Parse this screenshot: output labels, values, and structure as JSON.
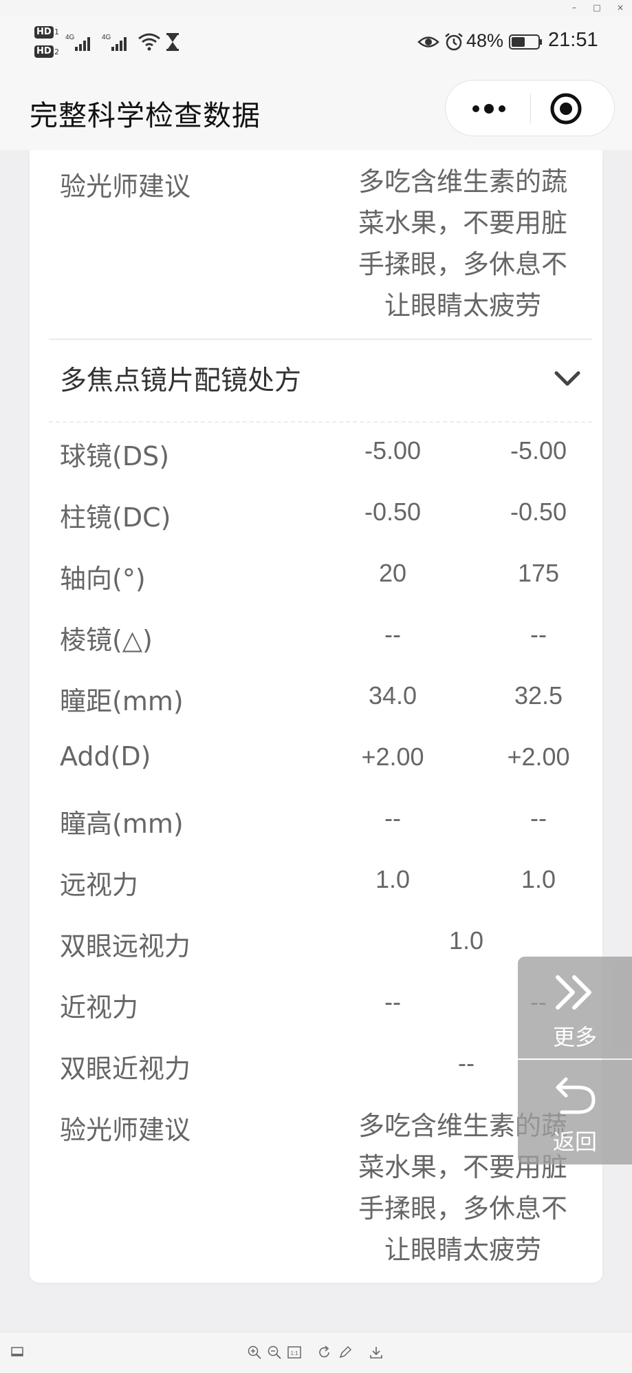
{
  "window": {
    "minimize": "–",
    "maximize": "□",
    "close": "×"
  },
  "status_bar": {
    "sim1": "HD",
    "sim1_sub": "1",
    "sim2": "HD",
    "sim2_sub": "2",
    "network1": "4G",
    "network2": "4G",
    "battery": "48%",
    "time": "21:51",
    "icons": [
      "signal-icon",
      "signal-icon",
      "wifi-icon",
      "hourglass-icon",
      "eye-icon",
      "alarm-icon",
      "battery-icon"
    ]
  },
  "nav": {
    "title": "完整科学检查数据",
    "more_icon": "more-dots-icon",
    "close_icon": "target-close-icon"
  },
  "top_advice": {
    "label": "验光师建议",
    "text": "多吃含维生素的蔬菜水果，不要用脏手揉眼，多休息不让眼睛太疲劳"
  },
  "section": {
    "title": "多焦点镜片配镜处方",
    "toggle_icon": "chevron-down-icon"
  },
  "rows": [
    {
      "label": "球镜(DS)",
      "od": "-5.00",
      "os": "-5.00"
    },
    {
      "label": "柱镜(DC)",
      "od": "-0.50",
      "os": "-0.50"
    },
    {
      "label": "轴向(°)",
      "od": "20",
      "os": "175"
    },
    {
      "label": "棱镜(△)",
      "od": "--",
      "os": "--"
    },
    {
      "label": "瞳距(mm)",
      "od": "34.0",
      "os": "32.5"
    },
    {
      "label": "Add(D)",
      "od": "+2.00",
      "os": "+2.00"
    },
    {
      "label": "瞳高(mm)",
      "od": "--",
      "os": "--"
    },
    {
      "label": "远视力",
      "od": "1.0",
      "os": "1.0"
    }
  ],
  "binocular_far": {
    "label": "双眼远视力",
    "value": "1.0"
  },
  "near_vision": {
    "label": "近视力",
    "od": "--",
    "os": "--"
  },
  "binocular_near": {
    "label": "双眼近视力",
    "value": "--"
  },
  "bottom_advice": {
    "label": "验光师建议",
    "text": "多吃含维生素的蔬菜水果，不要用脏手揉眼，多休息不让眼睛太疲劳"
  },
  "float_buttons": {
    "more_label": "更多",
    "more_icon": "double-chevron-right-icon",
    "back_label": "返回",
    "back_icon": "undo-arrow-icon"
  },
  "bottom_toolbar": {
    "icons": [
      "screen-icon",
      "zoom-in-icon",
      "zoom-out-icon",
      "actual-size-icon",
      "rotate-icon",
      "edit-icon",
      "download-icon"
    ],
    "actual_size_text": "1:1"
  }
}
